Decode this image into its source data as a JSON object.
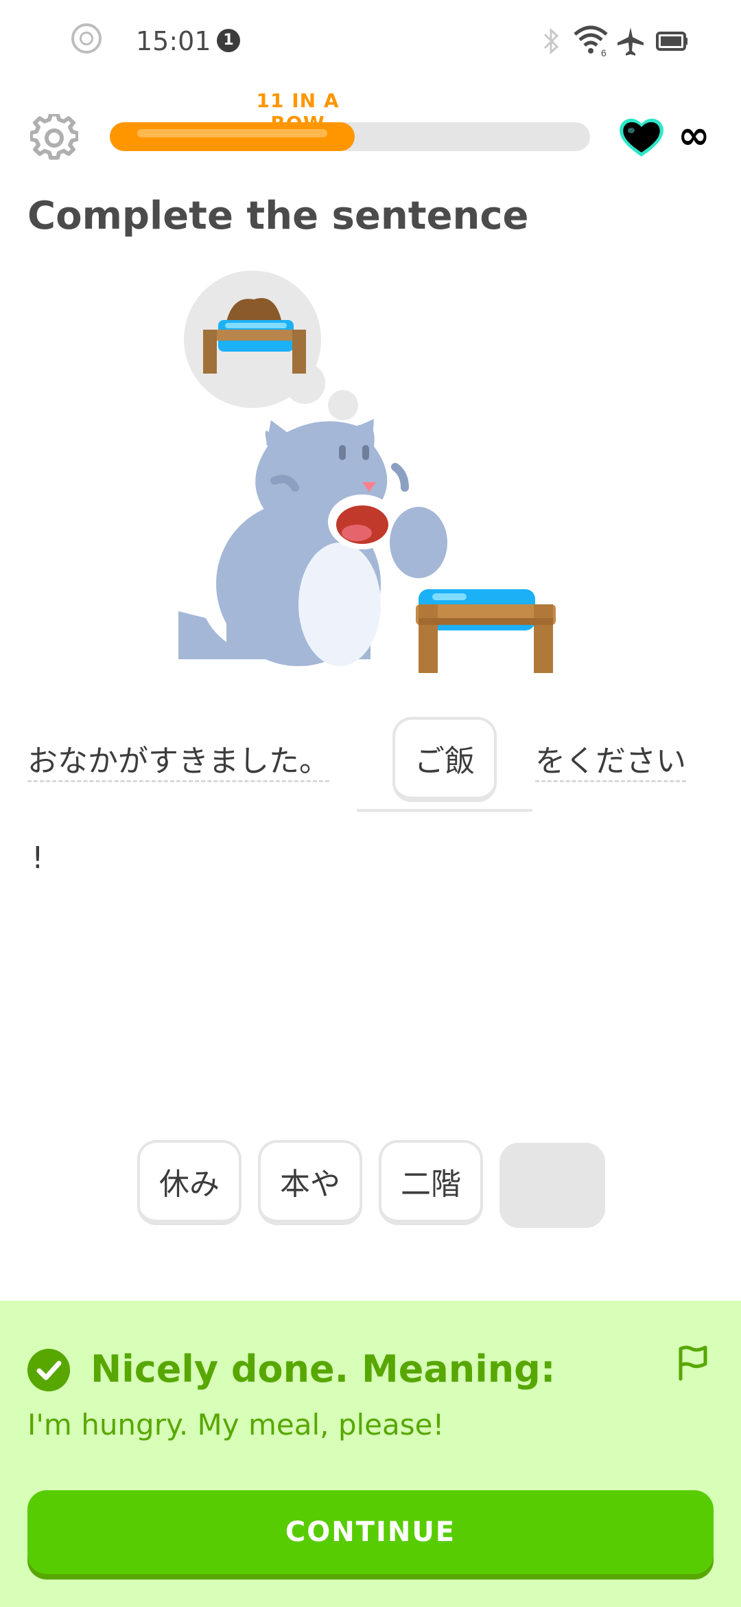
{
  "status_bar": {
    "time": "15:01",
    "notification_count": "1",
    "icons": [
      "bluetooth-icon",
      "wifi-icon",
      "airplane-mode-icon",
      "battery-icon"
    ]
  },
  "header": {
    "streak_label": "11 IN A ROW",
    "progress_fraction": 0.51,
    "hearts": "∞",
    "icons": [
      "settings-gear-icon",
      "heart-icon"
    ]
  },
  "exercise": {
    "title": "Complete the sentence",
    "sentence_prefix": "おなかがすきました。",
    "selected_answer": "ご飯",
    "sentence_suffix": "をください",
    "sentence_end": "!"
  },
  "word_bank": {
    "options": [
      "休み",
      "本や",
      "二階"
    ]
  },
  "feedback": {
    "title": "Nicely done. Meaning:",
    "meaning": "I'm hungry. My meal, please!",
    "continue_label": "CONTINUE",
    "colors": {
      "panel": "#d7ffb8",
      "accent": "#58a700",
      "button": "#58cc02"
    }
  },
  "colors": {
    "streak_orange": "#ff9600",
    "track_grey": "#e5e5e5"
  }
}
